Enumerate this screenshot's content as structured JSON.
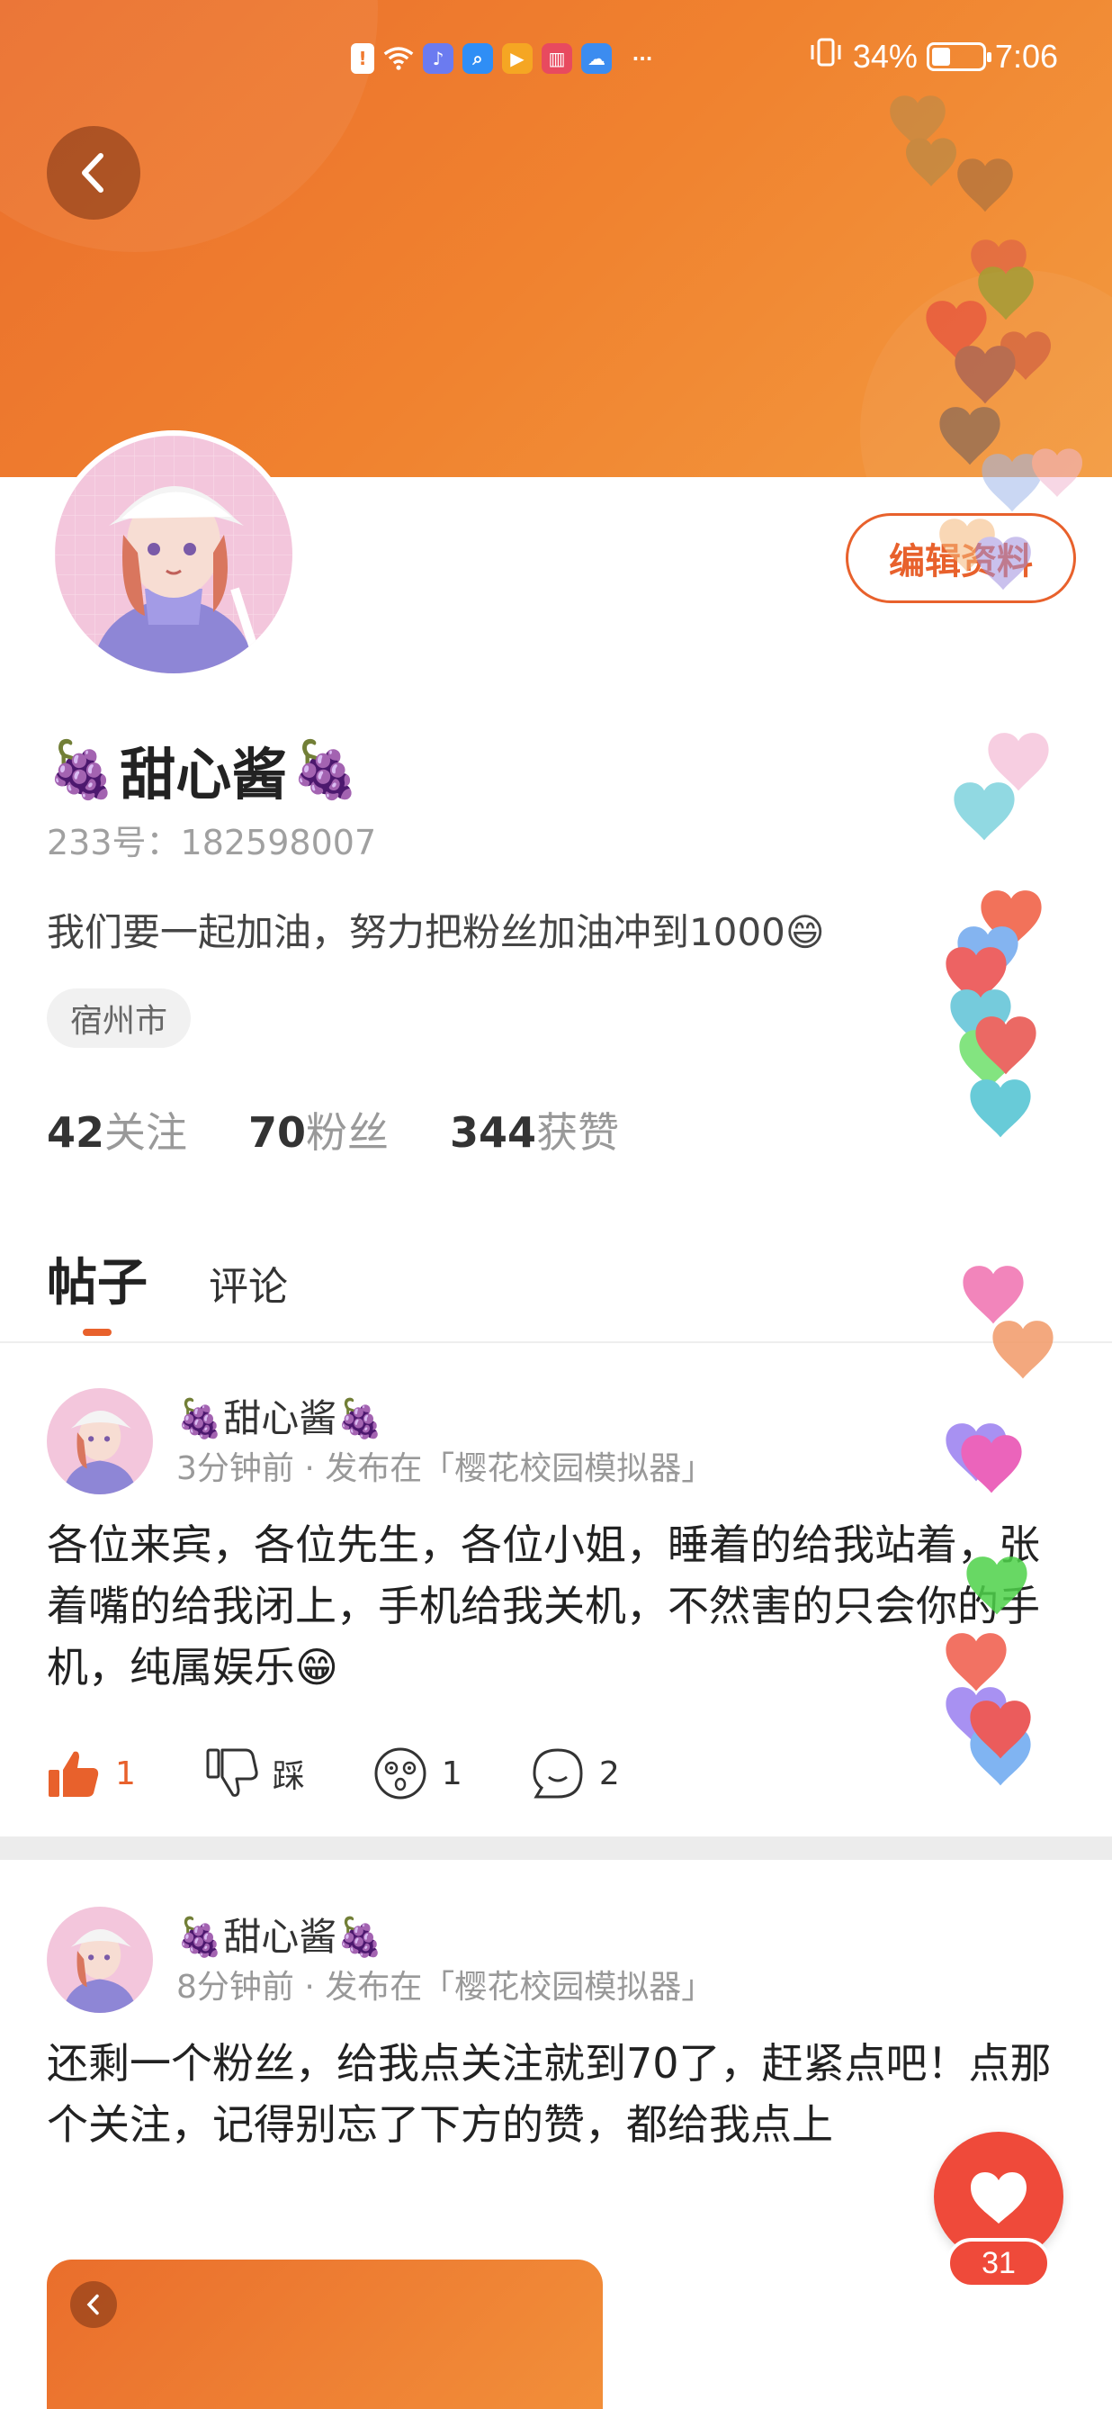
{
  "status_bar": {
    "battery": "34%",
    "time": "7:06",
    "more": "···",
    "notif_icons": [
      "alert-icon",
      "wifi-icon",
      "music-icon",
      "search-app-icon",
      "play-app-icon",
      "book-app-icon",
      "cloud-app-icon"
    ]
  },
  "header": {
    "back_icon": "chevron-left-icon"
  },
  "profile": {
    "name": "甜心酱",
    "name_emoji": "🍇",
    "uid": "233号：182598007",
    "bio": "我们要一起加油，努力把粉丝加油冲到1000😄",
    "location": "宿州市",
    "edit_label": "编辑资料",
    "stats": [
      {
        "num": "42",
        "label": "关注"
      },
      {
        "num": "70",
        "label": "粉丝"
      },
      {
        "num": "344",
        "label": "获赞"
      }
    ]
  },
  "tabs": {
    "active": "帖子",
    "other": "评论"
  },
  "posts": [
    {
      "author": "🍇甜心酱🍇",
      "meta": "3分钟前 · 发布在「樱花校园模拟器」",
      "body": "各位来宾，各位先生，各位小姐，睡着的给我站着，张着嘴的给我闭上，手机给我关机，不然害的只会你的手机，纯属娱乐😁",
      "likes": "1",
      "dislike_label": "踩",
      "reactions": "1",
      "comments": "2"
    },
    {
      "author": "🍇甜心酱🍇",
      "meta": "8分钟前 · 发布在「樱花校园模拟器」",
      "body": "还剩一个粉丝，给我点关注就到70了，赶紧点吧！点那个关注，记得别忘了下方的赞，都给我点上"
    }
  ],
  "floating_like": {
    "count": "31"
  },
  "colors": {
    "accent": "#e8612c",
    "banner": "#f0822f",
    "like_red": "#ef4a3a"
  }
}
